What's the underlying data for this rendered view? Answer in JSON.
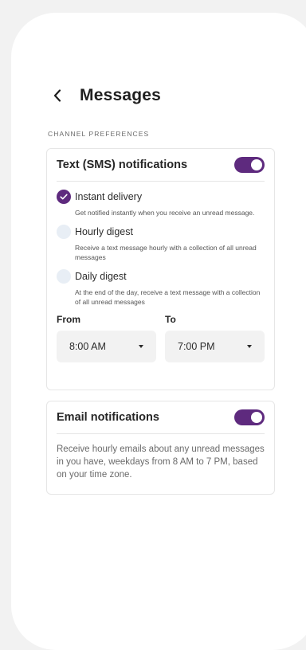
{
  "header": {
    "back_icon": "chevron-left-icon",
    "title": "Messages"
  },
  "section": {
    "label": "CHANNEL PREFERENCES"
  },
  "colors": {
    "accent": "#5e2a7e",
    "radio_unchecked": "#e8eef5",
    "select_bg": "#f2f2f2"
  },
  "sms": {
    "title": "Text (SMS) notifications",
    "enabled": true,
    "options": [
      {
        "label": "Instant delivery",
        "description": "Get notified instantly when you receive an unread message.",
        "selected": true
      },
      {
        "label": "Hourly digest",
        "description": "Receive a text message hourly with a collection of all unread messages",
        "selected": false
      },
      {
        "label": "Daily digest",
        "description": "At the end of the day, receive a text message with a collection of all unread messages",
        "selected": false
      }
    ],
    "from": {
      "label": "From",
      "value": "8:00 AM"
    },
    "to": {
      "label": "To",
      "value": "7:00 PM"
    }
  },
  "email": {
    "title": "Email notifications",
    "enabled": true,
    "description": "Receive hourly emails about any unread messages in you have, weekdays from 8 AM to 7 PM, based on your time zone."
  }
}
